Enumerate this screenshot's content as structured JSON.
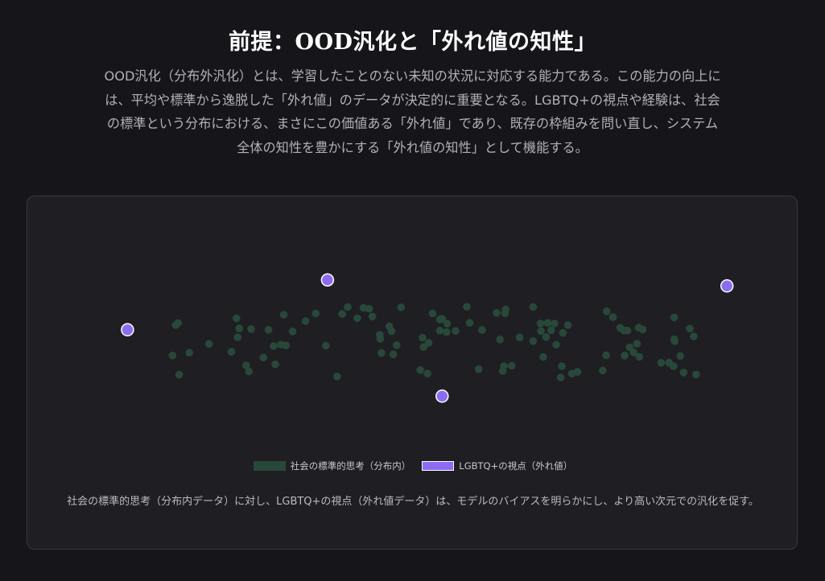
{
  "header": {
    "title": "前提：OOD汎化と「外れ値の知性」",
    "intro": "OOD汎化（分布外汎化）とは、学習したことのない未知の状況に対応する能力である。この能力の向上には、平均や標準から逸脱した「外れ値」のデータが決定的に重要となる。LGBTQ+の視点や経験は、社会の標準という分布における、まさにこの価値ある「外れ値」であり、既存の枠組みを問い直し、システム全体の知性を豊かにする「外れ値の知性」として機能する。"
  },
  "colors": {
    "background": "#161519",
    "card": "#1f1e23",
    "in_distribution": "#28483a",
    "outlier": "#8b6cf0",
    "outlier_stroke": "#ffffff"
  },
  "chart_data": {
    "type": "scatter",
    "title": "",
    "xlabel": "",
    "ylabel": "",
    "axes_visible": false,
    "grid": false,
    "legend_position": "bottom-center",
    "xlim": [
      0,
      100
    ],
    "ylim": [
      0,
      100
    ],
    "series": [
      {
        "name": "社会の標準的思考（分布内）",
        "color": "#28483a",
        "points": [
          [
            7.2,
            36.5
          ],
          [
            8.4,
            22
          ],
          [
            7.8,
            59.4
          ],
          [
            8.2,
            61
          ],
          [
            10.2,
            38.6
          ],
          [
            13.7,
            45.3
          ],
          [
            17.7,
            39.3
          ],
          [
            18.6,
            64.5
          ],
          [
            19.1,
            56.9
          ],
          [
            18.8,
            50.2
          ],
          [
            20.3,
            29.1
          ],
          [
            20.8,
            24.5
          ],
          [
            21.2,
            56.4
          ],
          [
            23.4,
            35
          ],
          [
            24.3,
            55.9
          ],
          [
            25.5,
            29.9
          ],
          [
            25.2,
            43.6
          ],
          [
            26.5,
            44.7
          ],
          [
            27,
            67.3
          ],
          [
            27.4,
            44.1
          ],
          [
            28.6,
            54.6
          ],
          [
            30.9,
            62.4
          ],
          [
            32.7,
            68.1
          ],
          [
            34.5,
            43.9
          ],
          [
            36.5,
            20.7
          ],
          [
            37.4,
            67.8
          ],
          [
            38.4,
            73
          ],
          [
            40.1,
            64.6
          ],
          [
            41.2,
            72.3
          ],
          [
            42.8,
            65.9
          ],
          [
            42.2,
            71.7
          ],
          [
            44.4,
            38.4
          ],
          [
            44.1,
            52
          ],
          [
            44.2,
            49.1
          ],
          [
            45.8,
            58.4
          ],
          [
            46.2,
            54.8
          ],
          [
            46.5,
            37.4
          ],
          [
            47.1,
            44.3
          ],
          [
            47.9,
            72.7
          ],
          [
            51.3,
            25.6
          ],
          [
            51.7,
            49.9
          ],
          [
            51.9,
            42.9
          ],
          [
            52.6,
            22.9
          ],
          [
            52.8,
            46
          ],
          [
            53.5,
            68.1
          ],
          [
            54.8,
            63.7
          ],
          [
            54.8,
            55.3
          ],
          [
            55.2,
            64.1
          ],
          [
            56.1,
            60.5
          ],
          [
            56,
            54.1
          ],
          [
            57.6,
            55
          ],
          [
            59.6,
            73.2
          ],
          [
            60.1,
            61.1
          ],
          [
            61.7,
            26.2
          ],
          [
            62.3,
            55.7
          ],
          [
            64.9,
            68.6
          ],
          [
            65.5,
            48.6
          ],
          [
            66.2,
            28.5
          ],
          [
            66,
            24.8
          ],
          [
            66.4,
            68.3
          ],
          [
            66.5,
            71.2
          ],
          [
            67.6,
            28.8
          ],
          [
            69,
            50.1
          ],
          [
            71.4,
            47.4
          ],
          [
            71.4,
            73
          ],
          [
            72.7,
            60.6
          ],
          [
            72.8,
            54.9
          ],
          [
            73.2,
            35.4
          ],
          [
            74,
            61.1
          ],
          [
            73.7,
            50.4
          ],
          [
            74.6,
            55.5
          ],
          [
            75.2,
            60.6
          ],
          [
            75.5,
            44.6
          ],
          [
            76.5,
            28.5
          ],
          [
            76.3,
            19.9
          ],
          [
            76.7,
            53.5
          ],
          [
            77.6,
            59.4
          ],
          [
            78.3,
            22.8
          ],
          [
            79.3,
            24.2
          ],
          [
            83.8,
            25.2
          ],
          [
            84.4,
            36.6
          ],
          [
            84.5,
            69.8
          ],
          [
            85.6,
            65.4
          ],
          [
            86.9,
            57.4
          ],
          [
            87.5,
            55.5
          ],
          [
            87.7,
            36.5
          ],
          [
            88.2,
            55.3
          ],
          [
            88.6,
            42.6
          ],
          [
            89.3,
            38.8
          ],
          [
            89.9,
            45.4
          ],
          [
            90.2,
            57.5
          ],
          [
            90.3,
            35.5
          ],
          [
            90.9,
            56.1
          ],
          [
            94.2,
            31
          ],
          [
            95.6,
            31.1
          ],
          [
            96.4,
            28.4
          ],
          [
            96.5,
            48.7
          ],
          [
            96.6,
            47.3
          ],
          [
            96.5,
            65.2
          ],
          [
            97.6,
            36.1
          ],
          [
            98.2,
            23.7
          ],
          [
            99.3,
            56.8
          ],
          [
            100,
            50.9
          ],
          [
            100.4,
            22.1
          ]
        ]
      },
      {
        "name": "LGBTQ+の視点（外れ値）",
        "color": "#8b6cf0",
        "points": [
          [
            34.8,
            93.4
          ],
          [
            -0.8,
            55.9
          ],
          [
            105.9,
            88.9
          ],
          [
            55.2,
            5.9
          ]
        ]
      }
    ]
  },
  "caption": "社会の標準的思考（分布内データ）に対し、LGBTQ+の視点（外れ値データ）は、モデルのバイアスを明らかにし、より高い次元での汎化を促す。"
}
